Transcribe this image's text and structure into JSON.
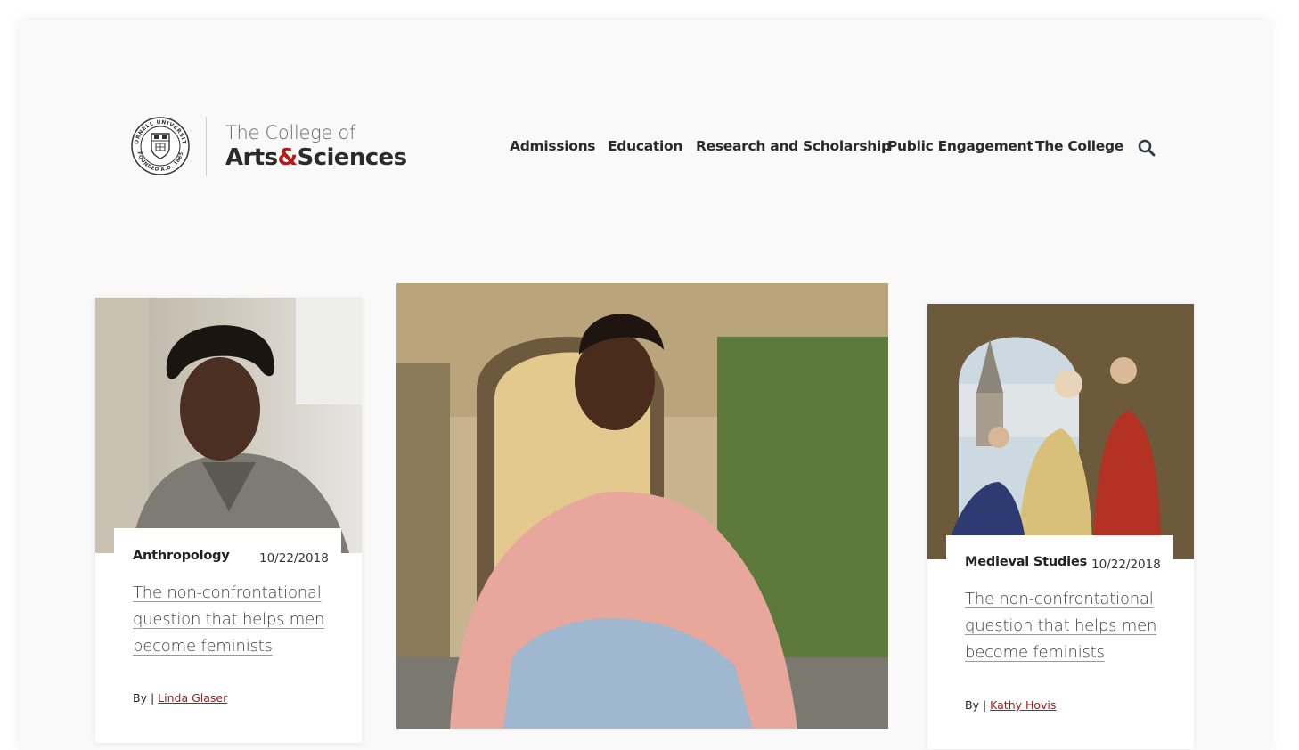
{
  "header": {
    "logo_seal_top_text": "CORNELL UNIVERSITY",
    "logo_seal_bottom_text": "FOUNDED A.D. 1865",
    "logo_line1": "The College of",
    "logo_line2_a": "Arts",
    "logo_line2_amp": "&",
    "logo_line2_b": "Sciences",
    "nav": [
      {
        "label": "Admissions"
      },
      {
        "label": "Education"
      },
      {
        "label": "Research and Scholarship"
      },
      {
        "label": "Public Engagement"
      },
      {
        "label": "The College"
      }
    ],
    "search_icon": "search-icon"
  },
  "colors": {
    "accent": "#b31b1b",
    "background": "#f9f9f9",
    "author_link": "#a31f1f"
  },
  "articles": [
    {
      "image": "portrait-man-grey-sweater",
      "category": "Anthropology",
      "date": "10/22/2018",
      "headline": "The non-confrontational question that helps men become feminists",
      "by": "By |",
      "author": "Linda Glaser"
    },
    {
      "image": "student-pink-hoodie-sitting"
    },
    {
      "image": "medieval-illustration",
      "category": "Medieval Studies",
      "date": "10/22/2018",
      "headline": "The non-confrontational question that helps men become feminists",
      "by": "By |",
      "author": "Kathy Hovis"
    }
  ]
}
